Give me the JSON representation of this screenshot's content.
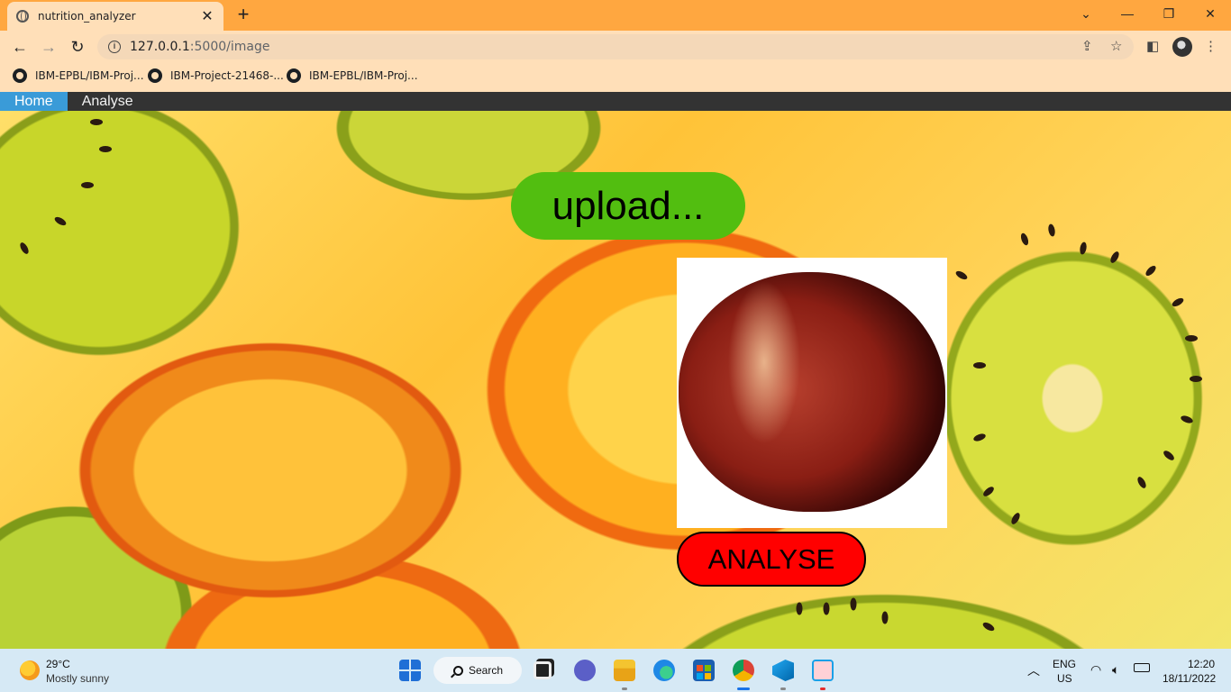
{
  "browser": {
    "tab_title": "nutrition_analyzer",
    "tab_close": "✕",
    "new_tab": "+",
    "url_host": "127.0.0.1",
    "url_rest": ":5000/image",
    "window_controls": {
      "minimize": "—",
      "maximize": "❐",
      "close": "✕"
    },
    "bookmarks": [
      {
        "label": "IBM-EPBL/IBM-Proj..."
      },
      {
        "label": "IBM-Project-21468-..."
      },
      {
        "label": "IBM-EPBL/IBM-Proj..."
      }
    ]
  },
  "app": {
    "nav": [
      {
        "label": "Home",
        "active": true
      },
      {
        "label": "Analyse",
        "active": false
      }
    ],
    "upload_label": "upload...",
    "analyse_label": "ANALYSE",
    "colors": {
      "upload": "#52be10",
      "analyse": "#ff0000",
      "nav_active": "#3a9bd8",
      "nav_bg": "#333333"
    }
  },
  "taskbar": {
    "weather": {
      "temp": "29°C",
      "desc": "Mostly sunny"
    },
    "search_label": "Search",
    "language": {
      "lang": "ENG",
      "region": "US"
    },
    "clock": {
      "time": "12:20",
      "date": "18/11/2022"
    },
    "icons": [
      "start-icon",
      "search-icon",
      "task-view-icon",
      "teams-icon",
      "file-explorer-icon",
      "edge-icon",
      "store-icon",
      "chrome-icon",
      "vscode-icon",
      "app-icon"
    ]
  }
}
